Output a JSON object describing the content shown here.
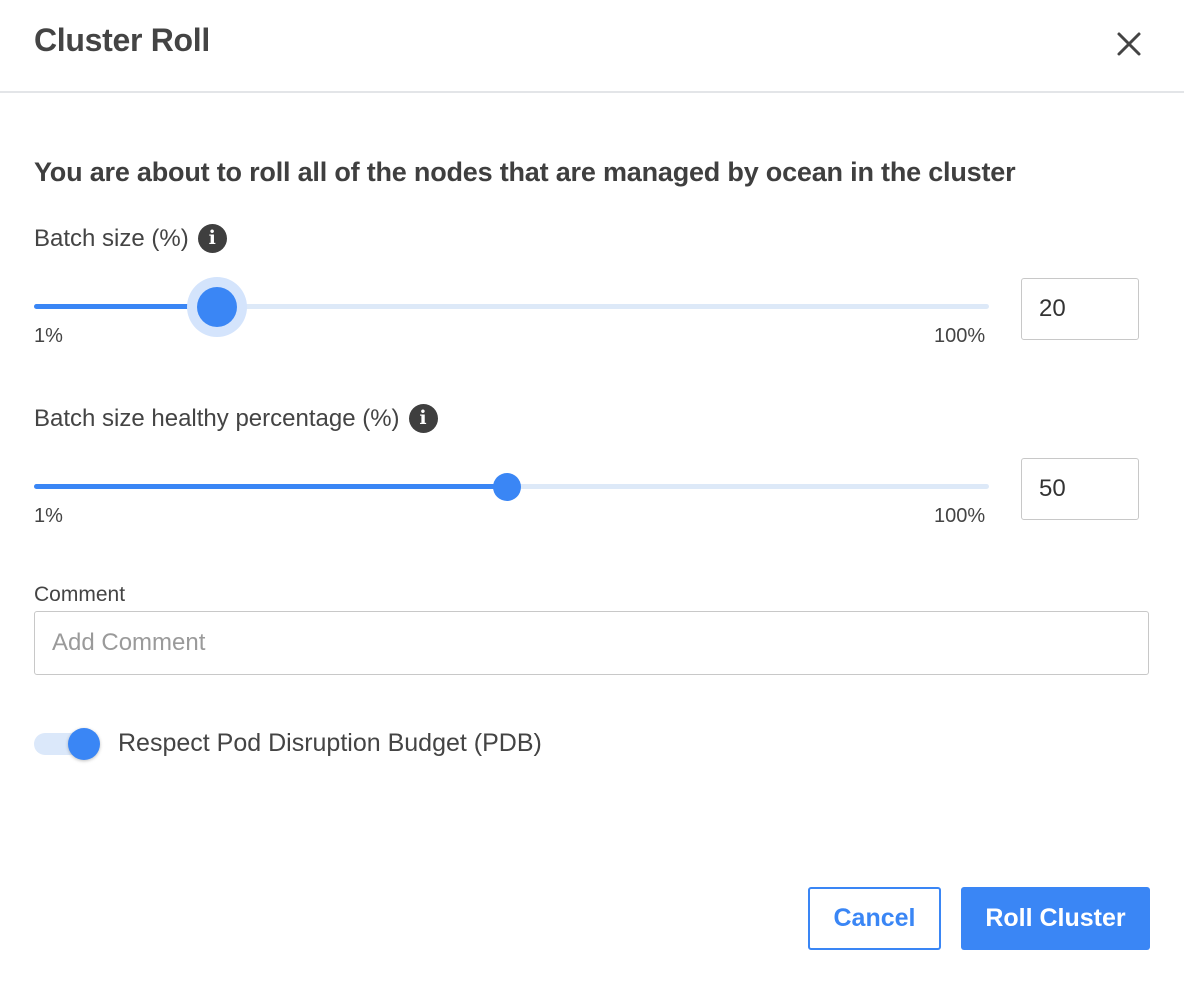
{
  "dialog": {
    "title": "Cluster Roll",
    "close_icon": "close-icon"
  },
  "intro": "You are about to roll all of the nodes that are managed by ocean in the cluster",
  "batch_size": {
    "label": "Batch size (%)",
    "info_icon": "info-icon",
    "info_glyph": "i",
    "min_label": "1%",
    "max_label": "100%",
    "value": "20",
    "active": true
  },
  "healthy_percentage": {
    "label": "Batch size healthy percentage (%)",
    "info_icon": "info-icon",
    "info_glyph": "i",
    "min_label": "1%",
    "max_label": "100%",
    "value": "50",
    "active": false
  },
  "comment": {
    "label": "Comment",
    "placeholder": "Add Comment",
    "value": ""
  },
  "pdb_toggle": {
    "label": "Respect Pod Disruption Budget (PDB)",
    "checked": true
  },
  "buttons": {
    "cancel": "Cancel",
    "submit": "Roll Cluster"
  },
  "colors": {
    "accent": "#3a86f5",
    "track": "#dde9f8",
    "text": "#444444",
    "border": "#c8c8c8"
  }
}
